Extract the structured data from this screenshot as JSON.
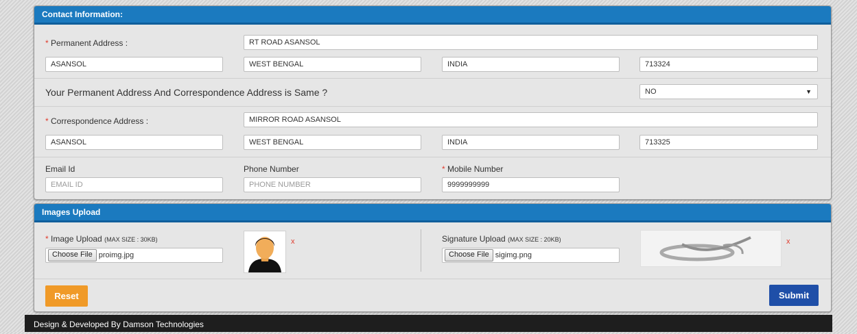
{
  "contact": {
    "title": "Contact Information:",
    "permanent_label": "Permanent Address :",
    "permanent_address": "RT ROAD ASANSOL",
    "permanent_city": "ASANSOL",
    "permanent_state": "WEST BENGAL",
    "permanent_country": "INDIA",
    "permanent_pin": "713324",
    "same_question": "Your Permanent Address And Correspondence Address is Same ?",
    "same_value": "NO",
    "correspondence_label": "Correspondence Address :",
    "correspondence_address": "MIRROR ROAD ASANSOL",
    "correspondence_city": "ASANSOL",
    "correspondence_state": "WEST BENGAL",
    "correspondence_country": "INDIA",
    "correspondence_pin": "713325",
    "email_label": "Email Id",
    "email_placeholder": "EMAIL ID",
    "phone_label": "Phone Number",
    "phone_placeholder": "PHONE NUMBER",
    "mobile_label": "Mobile Number",
    "mobile_value": "9999999999",
    "required_mark": "*"
  },
  "images": {
    "title": "Images Upload",
    "image_label": "Image Upload",
    "image_size": "(MAX SIZE : 30KB)",
    "image_file": "proimg.jpg",
    "signature_label": "Signature Upload",
    "signature_size": "(MAX SIZE : 20KB)",
    "signature_file": "sigimg.png",
    "choose_file": "Choose File",
    "remove": "x",
    "reset": "Reset",
    "submit": "Submit"
  },
  "colors": {
    "header_blue": "#1b7abf",
    "reset_orange": "#f09a28",
    "submit_blue": "#1f4fa8",
    "required_red": "#e03b2c"
  },
  "footer": "Design & Developed By Damson Technologies"
}
